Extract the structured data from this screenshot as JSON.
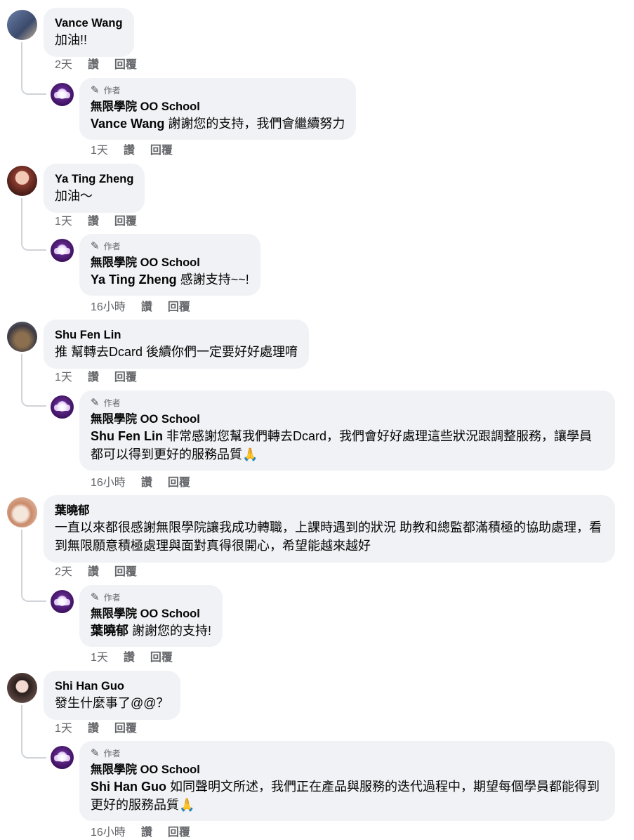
{
  "labels": {
    "like": "讚",
    "reply": "回覆",
    "author_badge": "作者"
  },
  "page_name": "無限學院 OO School",
  "threads": [
    {
      "user": "Vance Wang",
      "text": "加油!!",
      "time": "2天",
      "reply": {
        "mention": "Vance Wang",
        "text": " 謝謝您的支持，我們會繼續努力",
        "time": "1天"
      }
    },
    {
      "user": "Ya Ting Zheng",
      "text": "加油～",
      "time": "1天",
      "reply": {
        "mention": "Ya Ting Zheng",
        "text": " 感謝支持~~!",
        "time": "16小時"
      }
    },
    {
      "user": "Shu Fen Lin",
      "text": "推 幫轉去Dcard 後續你們一定要好好處理唷",
      "time": "1天",
      "reply": {
        "mention": "Shu Fen Lin",
        "text": " 非常感謝您幫我們轉去Dcard，我們會好好處理這些狀況跟調整服務，讓學員都可以得到更好的服務品質🙏",
        "time": "16小時"
      }
    },
    {
      "user": "葉曉郁",
      "text": "一直以來都很感謝無限學院讓我成功轉職，上課時遇到的狀況 助教和總監都滿積極的協助處理，看到無限願意積極處理與面對真得很開心，希望能越來越好",
      "time": "2天",
      "reply": {
        "mention": "葉曉郁",
        "text": " 謝謝您的支持!",
        "time": "1天"
      }
    },
    {
      "user": "Shi Han Guo",
      "text": "發生什麼事了@@？",
      "time": "1天",
      "reply": {
        "mention": "Shi Han Guo",
        "text": " 如同聲明文所述，我們正在產品與服務的迭代過程中，期望每個學員都能得到更好的服務品質🙏",
        "time": "16小時"
      }
    }
  ]
}
